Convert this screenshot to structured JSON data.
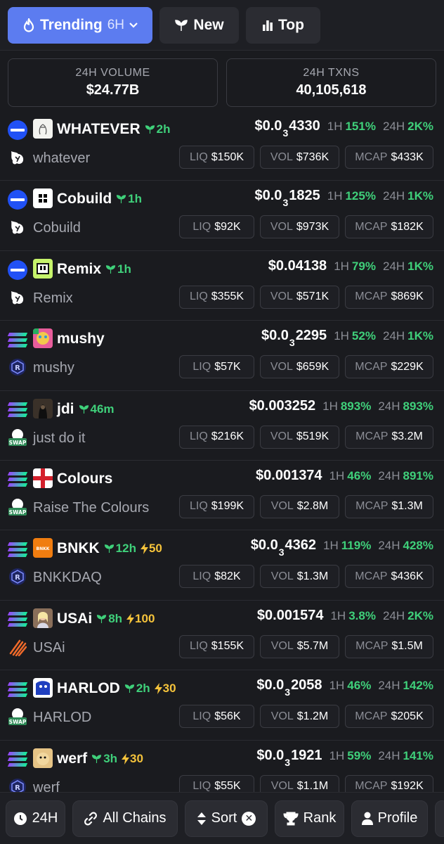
{
  "tabs": {
    "trending_label": "Trending",
    "trending_window": "6H",
    "new_label": "New",
    "top_label": "Top"
  },
  "stats": {
    "volume_label": "24H VOLUME",
    "volume_value": "$24.77B",
    "txns_label": "24H TXNS",
    "txns_value": "40,105,618"
  },
  "tokens": [
    {
      "chain": "base",
      "dex": "uniswap",
      "name": "WHATEVER",
      "age": "2h",
      "boost": "",
      "subname": "whatever",
      "price_prefix": "$0.0",
      "price_zeros": "3",
      "price_tail": "4330",
      "h1": "151%",
      "h24": "2K%",
      "liq": "$150K",
      "vol": "$736K",
      "mcap": "$433K"
    },
    {
      "chain": "base",
      "dex": "uniswap",
      "name": "Cobuild",
      "age": "1h",
      "boost": "",
      "subname": "Cobuild",
      "price_prefix": "$0.0",
      "price_zeros": "3",
      "price_tail": "1825",
      "h1": "125%",
      "h24": "1K%",
      "liq": "$92K",
      "vol": "$973K",
      "mcap": "$182K"
    },
    {
      "chain": "base",
      "dex": "uniswap",
      "name": "Remix",
      "age": "1h",
      "boost": "",
      "subname": "Remix",
      "price_prefix": "$0.04138",
      "price_zeros": "",
      "price_tail": "",
      "h1": "79%",
      "h24": "1K%",
      "liq": "$355K",
      "vol": "$571K",
      "mcap": "$869K"
    },
    {
      "chain": "solana",
      "dex": "raydium",
      "name": "mushy",
      "age": "",
      "boost": "",
      "subname": "mushy",
      "price_prefix": "$0.0",
      "price_zeros": "3",
      "price_tail": "2295",
      "h1": "52%",
      "h24": "1K%",
      "liq": "$57K",
      "vol": "$659K",
      "mcap": "$229K"
    },
    {
      "chain": "solana",
      "dex": "swap",
      "name": "jdi",
      "age": "46m",
      "boost": "",
      "subname": "just do it",
      "price_prefix": "$0.003252",
      "price_zeros": "",
      "price_tail": "",
      "h1": "893%",
      "h24": "893%",
      "liq": "$216K",
      "vol": "$519K",
      "mcap": "$3.2M"
    },
    {
      "chain": "solana",
      "dex": "swap",
      "name": "Colours",
      "age": "",
      "boost": "",
      "subname": "Raise The Colours",
      "price_prefix": "$0.001374",
      "price_zeros": "",
      "price_tail": "",
      "h1": "46%",
      "h24": "891%",
      "liq": "$199K",
      "vol": "$2.8M",
      "mcap": "$1.3M"
    },
    {
      "chain": "solana",
      "dex": "raydium",
      "name": "BNKK",
      "age": "12h",
      "boost": "50",
      "subname": "BNKKDAQ",
      "price_prefix": "$0.0",
      "price_zeros": "3",
      "price_tail": "4362",
      "h1": "119%",
      "h24": "428%",
      "liq": "$82K",
      "vol": "$1.3M",
      "mcap": "$436K"
    },
    {
      "chain": "solana",
      "dex": "meteora",
      "name": "USAi",
      "age": "8h",
      "boost": "100",
      "subname": "USAi",
      "price_prefix": "$0.001574",
      "price_zeros": "",
      "price_tail": "",
      "h1": "3.8%",
      "h24": "2K%",
      "liq": "$155K",
      "vol": "$5.7M",
      "mcap": "$1.5M"
    },
    {
      "chain": "solana",
      "dex": "swap",
      "name": "HARLOD",
      "age": "2h",
      "boost": "30",
      "subname": "HARLOD",
      "price_prefix": "$0.0",
      "price_zeros": "3",
      "price_tail": "2058",
      "h1": "46%",
      "h24": "142%",
      "liq": "$56K",
      "vol": "$1.2M",
      "mcap": "$205K"
    },
    {
      "chain": "solana",
      "dex": "raydium",
      "name": "werf",
      "age": "3h",
      "boost": "30",
      "subname": "werf",
      "price_prefix": "$0.0",
      "price_zeros": "3",
      "price_tail": "1921",
      "h1": "59%",
      "h24": "141%",
      "liq": "$55K",
      "vol": "$1.1M",
      "mcap": "$192K"
    }
  ],
  "labels": {
    "h1": "1H",
    "h24": "24H",
    "liq": "LIQ",
    "vol": "VOL",
    "mcap": "MCAP"
  },
  "bottom": {
    "time_label": "24H",
    "chains_label": "All Chains",
    "sort_label": "Sort",
    "rank_label": "Rank",
    "profile_label": "Profile"
  },
  "colors": {
    "accent": "#5c7cf0",
    "positive": "#3fd07a",
    "boost": "#f5c33b",
    "background": "#1a1b1f"
  }
}
